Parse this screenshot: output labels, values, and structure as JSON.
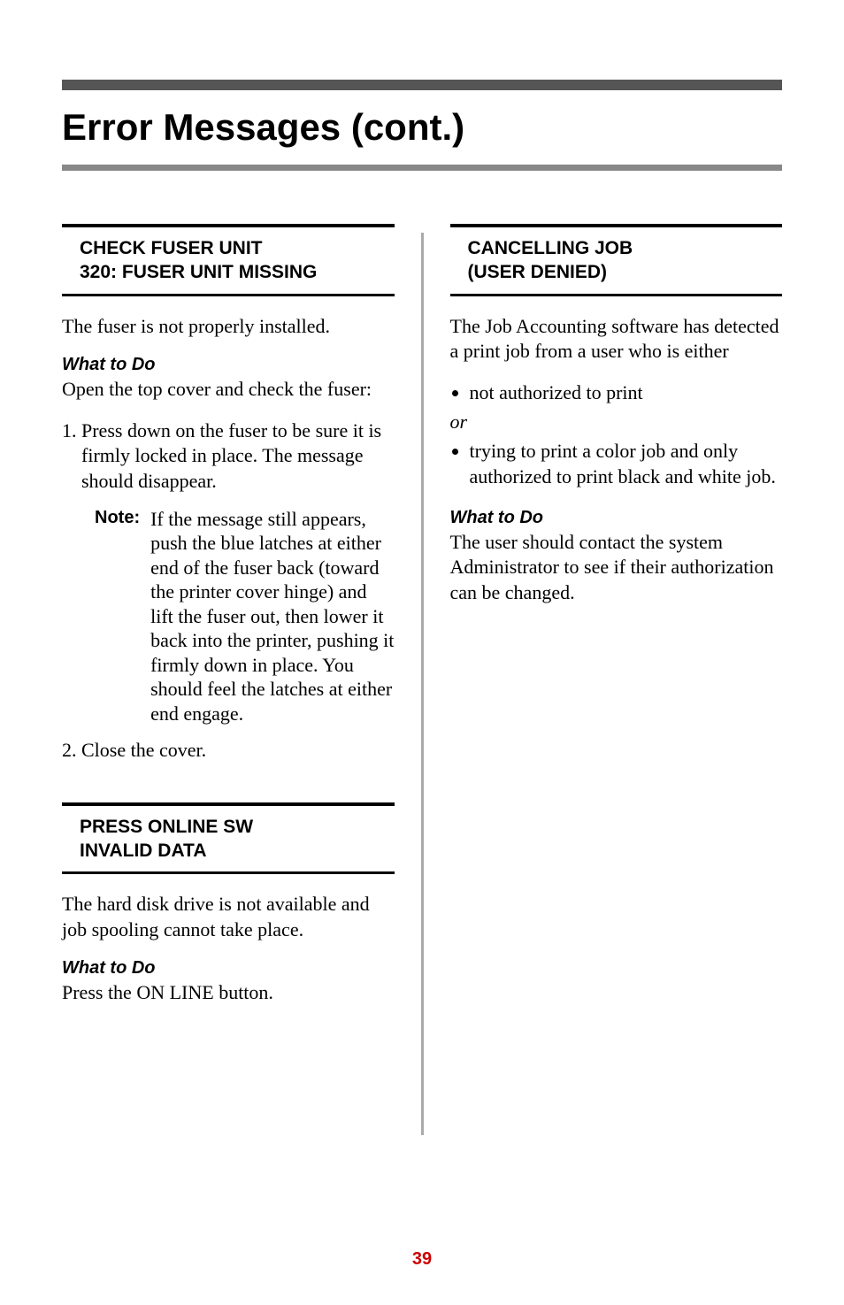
{
  "page_title": "Error Messages (cont.)",
  "page_number": "39",
  "left_column": {
    "section1": {
      "heading_line1": "CHECK FUSER UNIT",
      "heading_line2": "320: FUSER UNIT MISSING",
      "intro": "The fuser is not properly installed.",
      "subhead": "What to Do",
      "open_text": "Open the top cover and check the fuser:",
      "step1": "Press down on the fuser to be sure it is firmly locked in place. The message should disappear.",
      "note_label": "Note:",
      "note_text": "If the message still appears, push the blue latches at either end of the fuser back (toward the printer cover hinge) and lift the fuser out, then lower it back into the printer, pushing it firmly down in place. You should feel the latches at either end engage.",
      "step2": "Close the cover."
    },
    "section2": {
      "heading_line1": "PRESS ONLINE SW",
      "heading_line2": "INVALID DATA",
      "intro": "The hard disk drive is not available and job spooling cannot take place.",
      "subhead": "What to Do",
      "action": "Press the ON LINE button."
    }
  },
  "right_column": {
    "section1": {
      "heading_line1": "CANCELLING JOB",
      "heading_line2": "(USER DENIED)",
      "intro": "The Job Accounting software has detected a print job from a user who is either",
      "bullet1": "not authorized to print",
      "or_text": "or",
      "bullet2": "trying to print a color job and only authorized to print black and white job.",
      "subhead": "What to Do",
      "action": "The user should contact the system Administrator to see if their authorization can be changed."
    }
  }
}
